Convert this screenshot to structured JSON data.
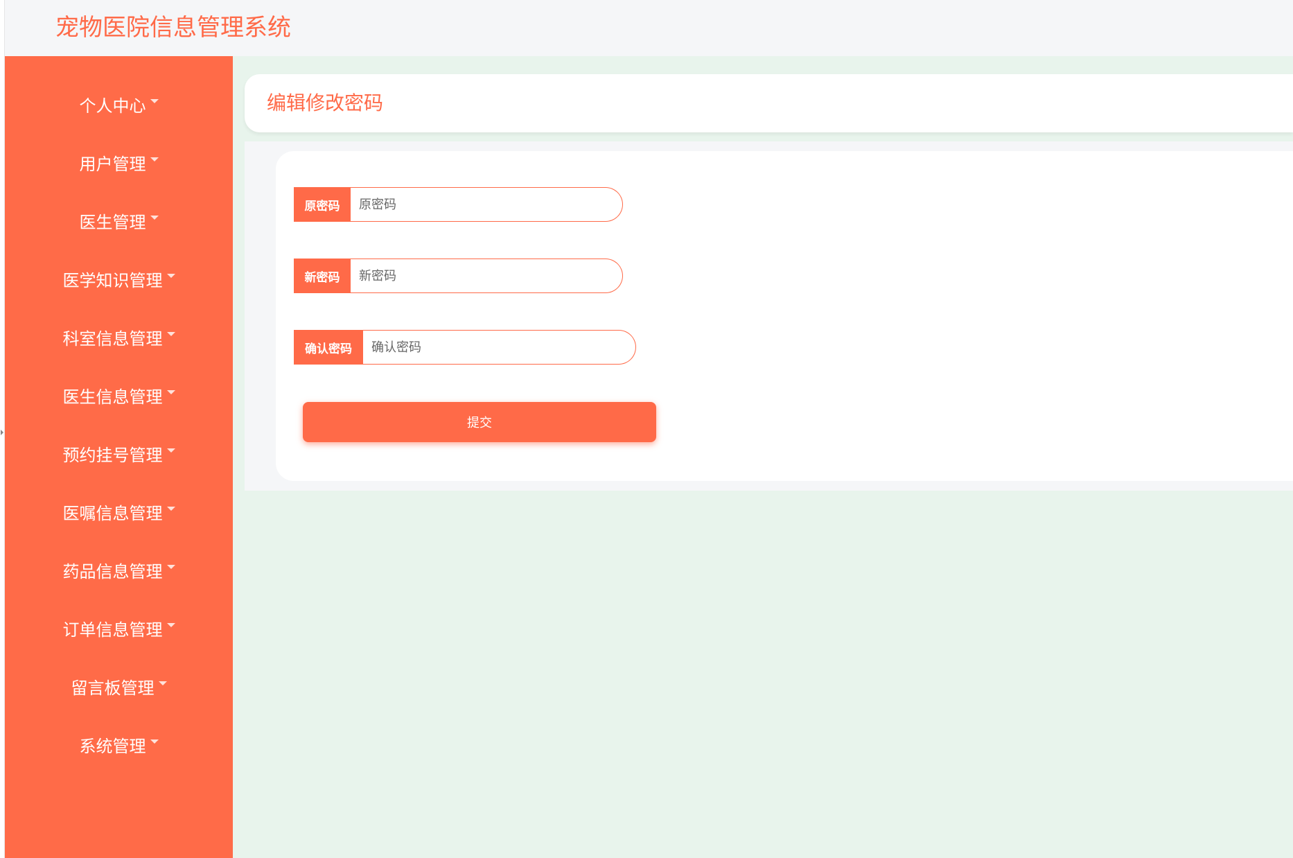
{
  "app": {
    "title": "宠物医院信息管理系统"
  },
  "colors": {
    "accent": "#ff6a48",
    "sidebar_bg": "#ff6b48",
    "main_bg": "#e8f4ec",
    "header_bg": "#f5f6f8"
  },
  "sidebar": {
    "items": [
      {
        "label": "个人中心",
        "icon": "caret-down-icon"
      },
      {
        "label": "用户管理",
        "icon": "caret-down-icon"
      },
      {
        "label": "医生管理",
        "icon": "caret-down-icon"
      },
      {
        "label": "医学知识管理",
        "icon": "caret-down-icon"
      },
      {
        "label": "科室信息管理",
        "icon": "caret-down-icon"
      },
      {
        "label": "医生信息管理",
        "icon": "caret-down-icon"
      },
      {
        "label": "预约挂号管理",
        "icon": "caret-down-icon"
      },
      {
        "label": "医嘱信息管理",
        "icon": "caret-down-icon"
      },
      {
        "label": "药品信息管理",
        "icon": "caret-down-icon"
      },
      {
        "label": "订单信息管理",
        "icon": "caret-down-icon"
      },
      {
        "label": "留言板管理",
        "icon": "caret-down-icon"
      },
      {
        "label": "系统管理",
        "icon": "caret-down-icon"
      }
    ]
  },
  "page": {
    "title": "编辑修改密码"
  },
  "form": {
    "fields": [
      {
        "label": "原密码",
        "placeholder": "原密码",
        "value": ""
      },
      {
        "label": "新密码",
        "placeholder": "新密码",
        "value": ""
      },
      {
        "label": "确认密码",
        "placeholder": "确认密码",
        "value": ""
      }
    ],
    "submit_label": "提交"
  }
}
